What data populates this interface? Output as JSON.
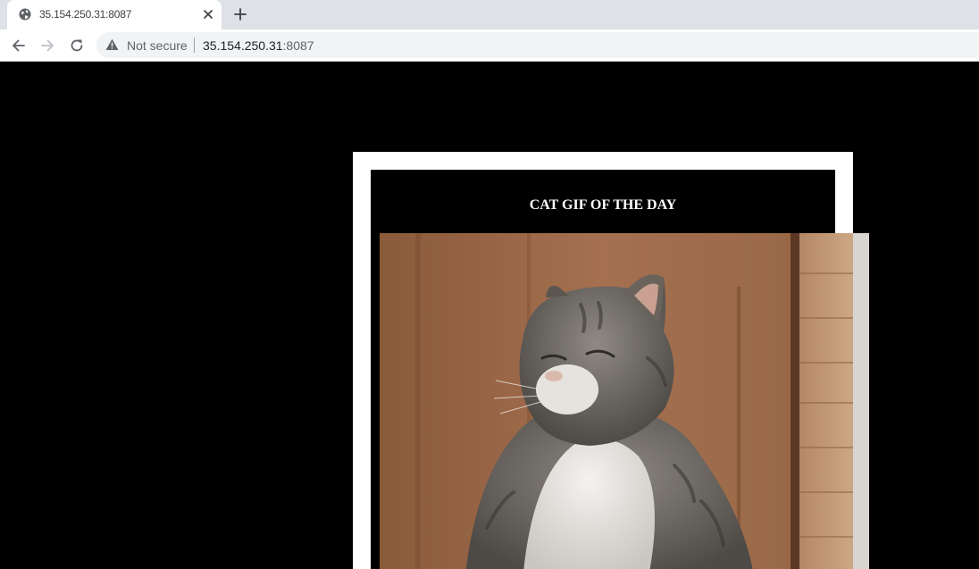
{
  "browser": {
    "tab": {
      "title": "35.154.250.31:8087",
      "favicon_icon": "globe-icon",
      "close_icon": "close-icon"
    },
    "new_tab_icon": "plus-icon",
    "toolbar": {
      "back_icon": "arrow-left-icon",
      "forward_icon": "arrow-right-icon",
      "reload_icon": "reload-icon"
    },
    "omnibox": {
      "security_icon": "warning-icon",
      "security_label": "Not secure",
      "host": "35.154.250.31",
      "port": ":8087"
    }
  },
  "page": {
    "heading": "CAT GIF OF THE DAY",
    "image": {
      "description_icon": "cat-photo",
      "subject": "tabby-and-white cat"
    },
    "colors": {
      "background": "#000000",
      "frame": "#ffffff",
      "heading_text": "#ffffff"
    }
  }
}
